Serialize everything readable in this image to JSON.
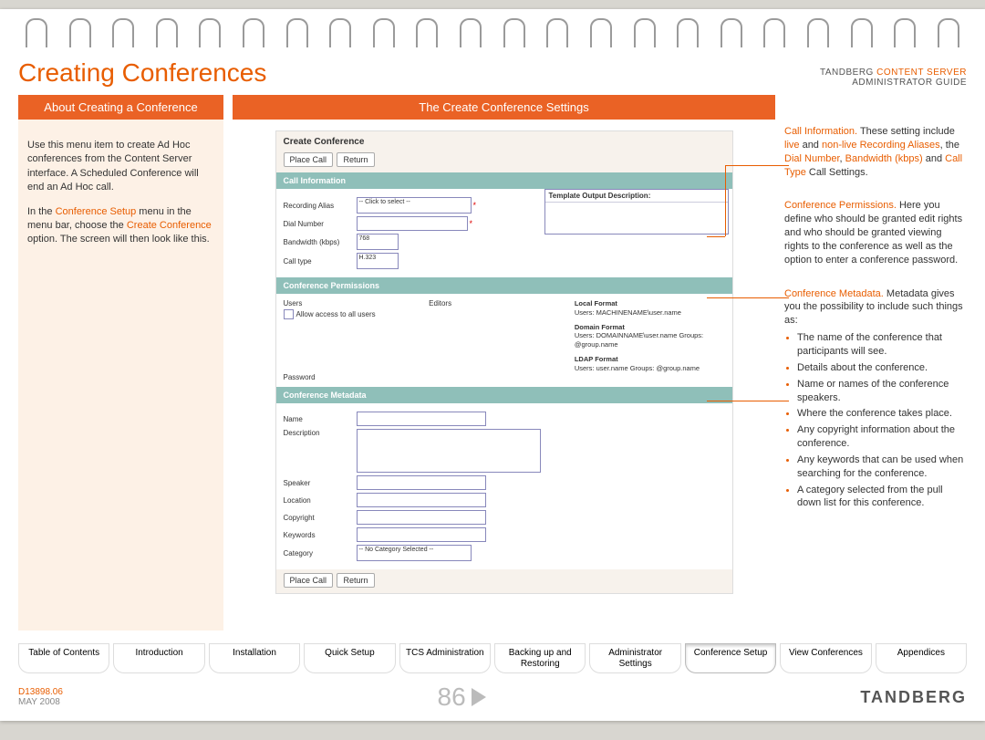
{
  "header": {
    "title": "Creating Conferences",
    "top_right_line1": "TANDBERG",
    "top_right_accent": "CONTENT SERVER",
    "top_right_line2": "ADMINISTRATOR GUIDE"
  },
  "left": {
    "heading": "About Creating a Conference",
    "p1": "Use this menu item to create Ad Hoc conferences from the Content Server interface. A Scheduled Conference will end an Ad Hoc call.",
    "p2a": "In the ",
    "p2b": "Conference Setup",
    "p2c": " menu in the menu bar, choose the ",
    "p2d": "Create Conference",
    "p2e": " option. The screen will then look like this."
  },
  "center": {
    "heading": "The Create Conference Settings",
    "shot_title": "Create Conference",
    "btn_place": "Place Call",
    "btn_return": "Return",
    "sec1": "Call Information",
    "sec2": "Conference Permissions",
    "sec3": "Conference Metadata",
    "f_recording_alias": "Recording Alias",
    "f_recording_value": "-- Click to select --",
    "f_dial_number": "Dial Number",
    "f_bandwidth": "Bandwidth (kbps)",
    "f_bandwidth_val": "768",
    "f_calltype": "Call type",
    "f_calltype_val": "H.323",
    "template_hd": "Template Output Description:",
    "perm_users": "Users",
    "perm_allow": "Allow access to all users",
    "perm_editors": "Editors",
    "perm_local_hd": "Local Format",
    "perm_local_txt": "Users: MACHINENAME\\user.name",
    "perm_domain_hd": "Domain Format",
    "perm_domain_txt": "Users: DOMAINNAME\\user.name  Groups: @group.name",
    "perm_ldap_hd": "LDAP Format",
    "perm_ldap_txt": "Users: user.name  Groups: @group.name",
    "perm_password": "Password",
    "m_name": "Name",
    "m_desc": "Description",
    "m_speaker": "Speaker",
    "m_location": "Location",
    "m_copyright": "Copyright",
    "m_keywords": "Keywords",
    "m_category": "Category",
    "m_category_val": "-- No Category Selected --"
  },
  "right": {
    "b1_lead": "Call Information.",
    "b1_txt1": " These setting include ",
    "b1_live": "live",
    "b1_and1": " and ",
    "b1_nonlive": "non-live",
    "b1_space": " ",
    "b1_ra": "Recording Aliases",
    "b1_mid": ", the ",
    "b1_dn": "Dial Number",
    "b1_c1": ", ",
    "b1_bw": "Bandwidth (kbps)",
    "b1_and2": " and ",
    "b1_ct": "Call Type",
    "b1_end": " Call Settings.",
    "b2_lead": "Conference Permissions.",
    "b2_txt": " Here you define who should be granted edit rights and who should be granted viewing rights to the conference as well as the option to enter a conference password.",
    "b3_lead": "Conference Metadata.",
    "b3_txt": " Metadata gives you the possibility to include such things as:",
    "b3_items": [
      "The name of the conference that participants will see.",
      "Details about the conference.",
      "Name or names of the conference speakers.",
      "Where the conference takes place.",
      "Any copyright information about the conference.",
      "Any keywords that can be used when searching for the conference.",
      "A category selected from the pull down list for this conference."
    ]
  },
  "tabs": [
    "Table of Contents",
    "Introduction",
    "Installation",
    "Quick Setup",
    "TCS Administration",
    "Backing up and Restoring",
    "Administrator Settings",
    "Conference Setup",
    "View Conferences",
    "Appendices"
  ],
  "footer": {
    "doc": "D13898.06",
    "date": "MAY 2008",
    "page": "86",
    "brand": "TANDBERG"
  }
}
